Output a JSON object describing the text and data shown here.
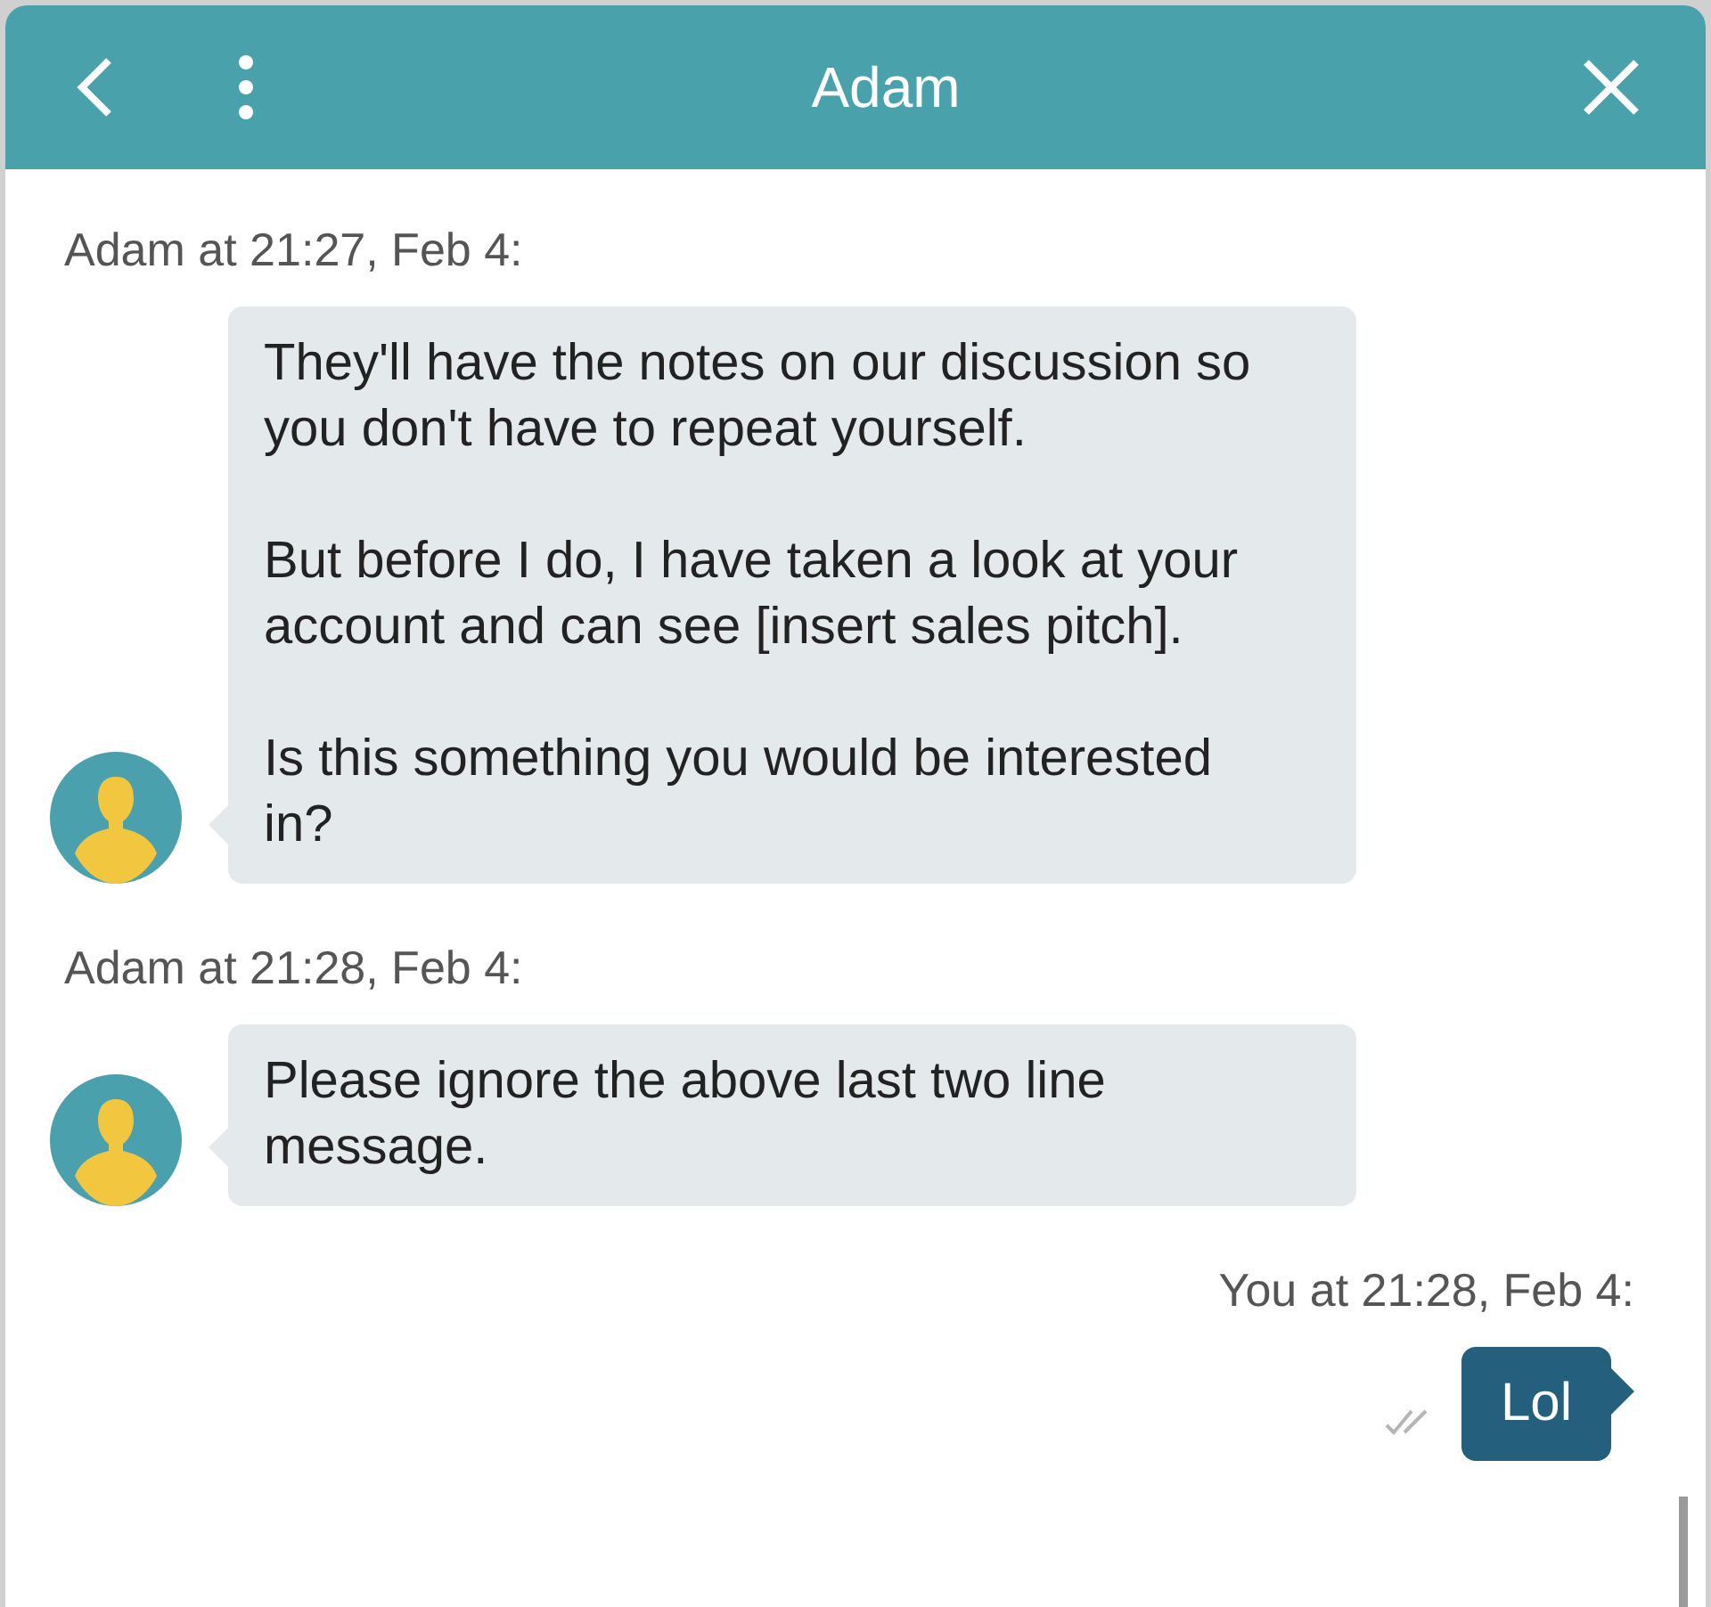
{
  "header": {
    "title": "Adam"
  },
  "messages": [
    {
      "kind": "incoming",
      "meta": "Adam at 21:27, Feb 4:",
      "paragraphs": [
        "They'll have the notes on our discussion so you don't have to repeat yourself.",
        "But before I do, I have taken a look at your account and can see [insert sales pitch].",
        "Is this something you would be interested in?"
      ]
    },
    {
      "kind": "incoming",
      "meta": "Adam at 21:28, Feb 4:",
      "paragraphs": [
        "Please ignore the above last two line message."
      ]
    },
    {
      "kind": "outgoing",
      "meta": "You at 21:28, Feb 4:",
      "paragraphs": [
        "Lol"
      ]
    }
  ]
}
